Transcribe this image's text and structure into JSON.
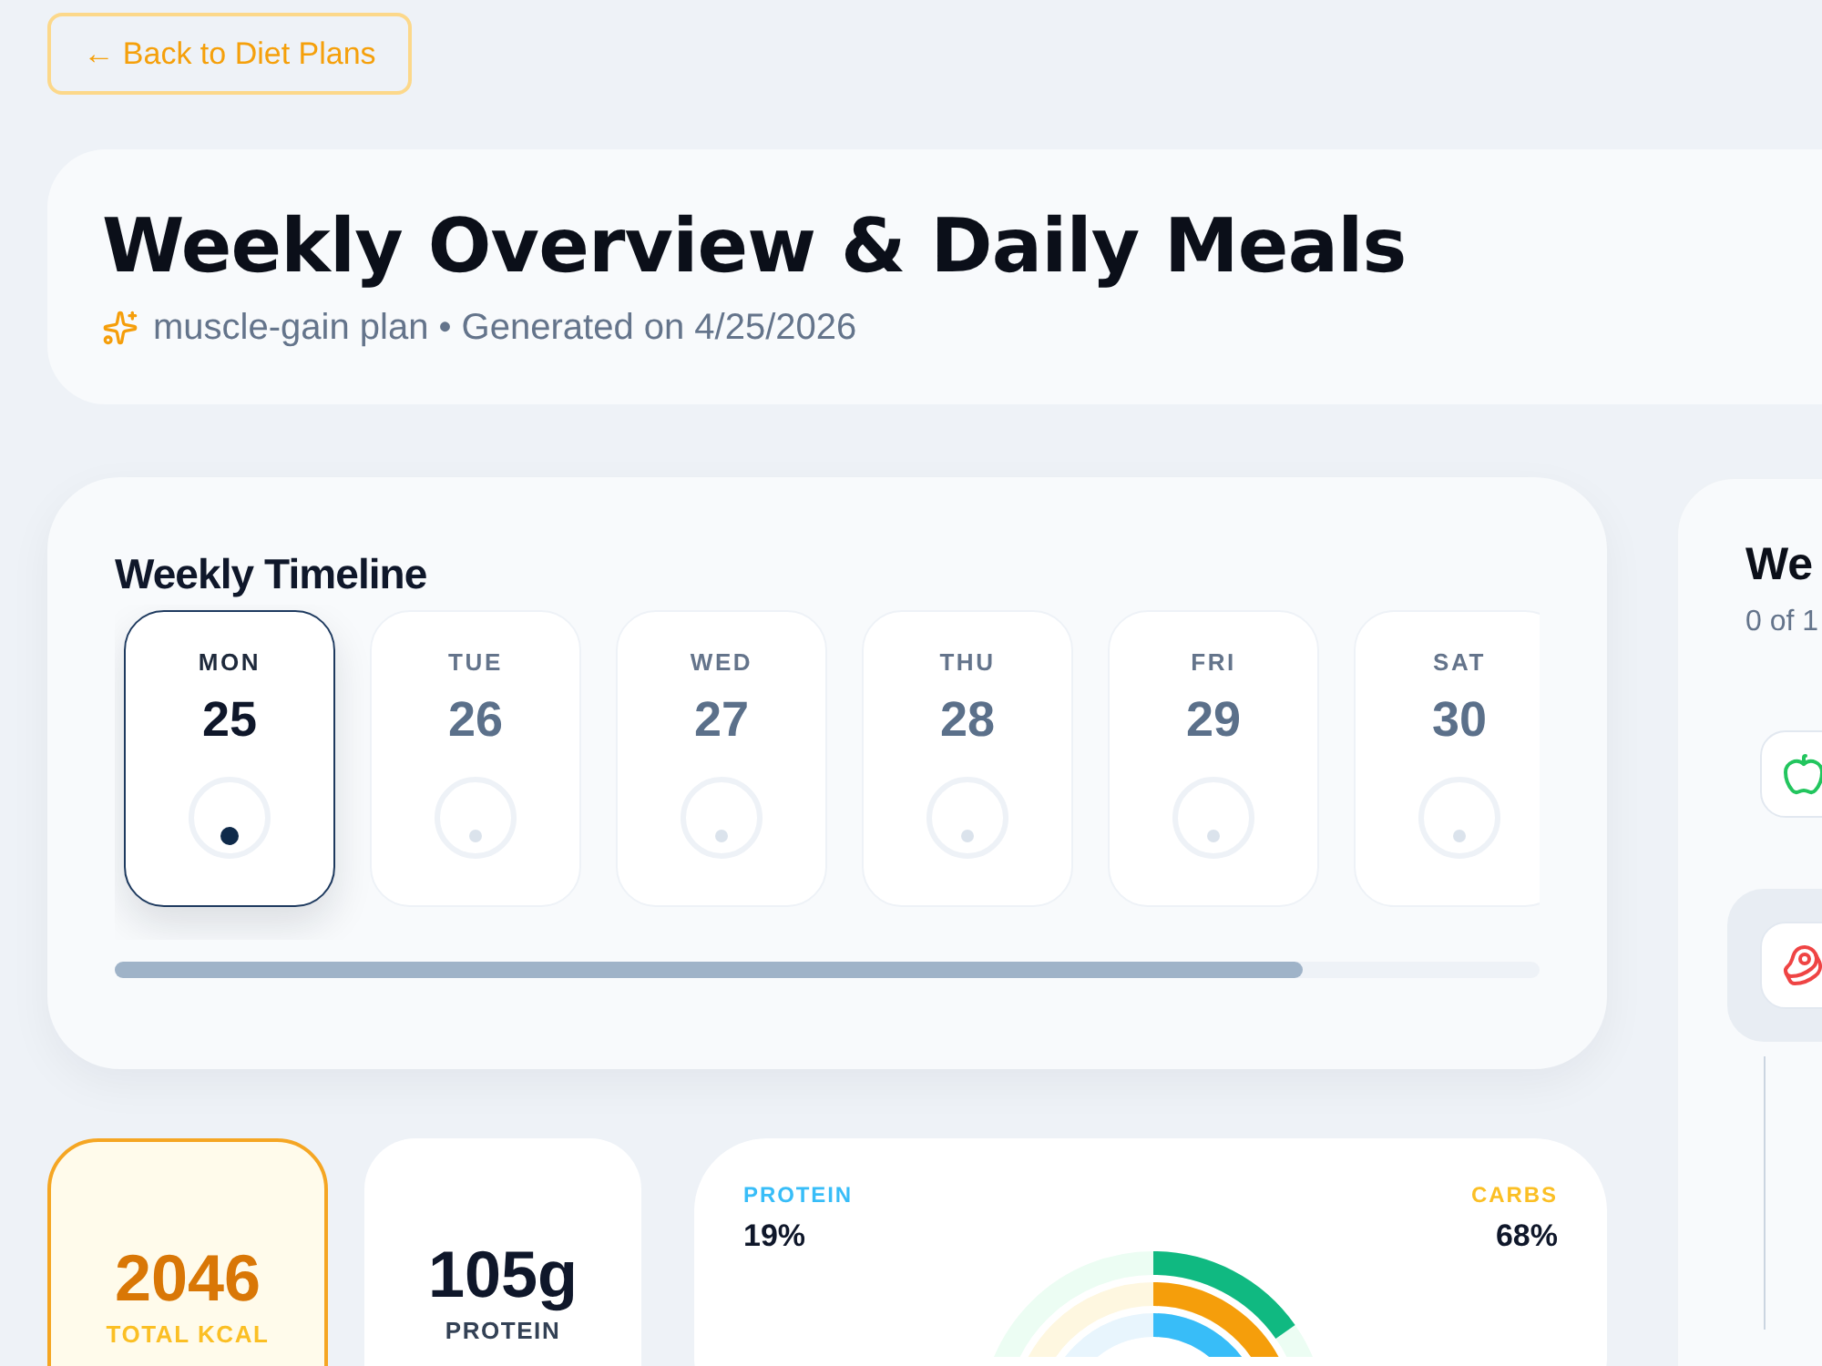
{
  "back_button": {
    "label": "← Back to Diet Plans"
  },
  "header": {
    "title": "Weekly Overview & Daily Meals",
    "subtitle": "muscle-gain plan • Generated on 4/25/2026"
  },
  "timeline": {
    "title": "Weekly Timeline",
    "days": [
      {
        "weekday": "MON",
        "date": "25",
        "selected": true
      },
      {
        "weekday": "TUE",
        "date": "26",
        "selected": false
      },
      {
        "weekday": "WED",
        "date": "27",
        "selected": false
      },
      {
        "weekday": "THU",
        "date": "28",
        "selected": false
      },
      {
        "weekday": "FRI",
        "date": "29",
        "selected": false
      },
      {
        "weekday": "SAT",
        "date": "30",
        "selected": false
      }
    ]
  },
  "stats": [
    {
      "kind": "highlight",
      "value": "2046",
      "label": "TOTAL KCAL"
    },
    {
      "kind": "plain",
      "value": "105g",
      "label": "PROTEIN"
    }
  ],
  "macros": {
    "items": [
      {
        "label": "PROTEIN",
        "value": "19%",
        "color": "#38bdf8"
      },
      {
        "label": "CARBS",
        "value": "68%",
        "color": "#fbbf24"
      }
    ]
  },
  "weekly_panel": {
    "title": "We",
    "subtitle": "0 of 1",
    "meals": [
      {
        "kind": "fruit",
        "selected": false
      },
      {
        "kind": "meat",
        "selected": true
      }
    ]
  }
}
